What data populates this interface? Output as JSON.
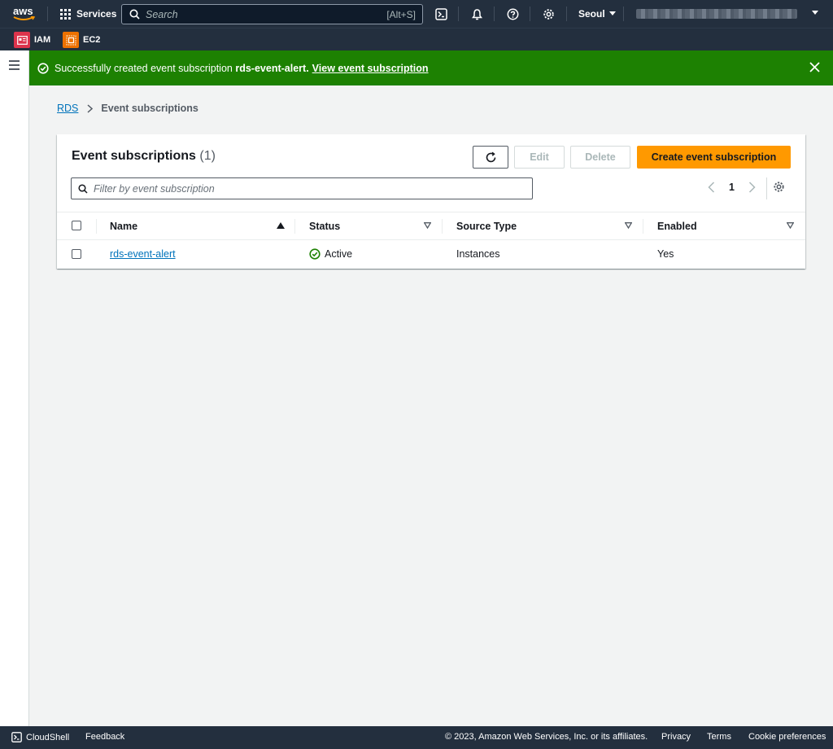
{
  "topnav": {
    "logo": "aws",
    "services_label": "Services",
    "search_placeholder": "Search",
    "search_shortcut": "[Alt+S]",
    "region_label": "Seoul",
    "brand_color": "#ff9900"
  },
  "favorites": [
    {
      "label": "IAM",
      "color": "#dd344c"
    },
    {
      "label": "EC2",
      "color": "#ed7100"
    }
  ],
  "flash": {
    "message": "Successfully created event subscription",
    "subscription_name": "rds-event-alert.",
    "link_label": "View event subscription",
    "color": "#1d8102"
  },
  "breadcrumb": {
    "root": "RDS",
    "current": "Event subscriptions"
  },
  "panel": {
    "title": "Event subscriptions",
    "count": "(1)",
    "edit_label": "Edit",
    "delete_label": "Delete",
    "create_label": "Create event subscription",
    "filter_placeholder": "Filter by event subscription",
    "page_number": "1"
  },
  "table": {
    "columns": [
      "Name",
      "Status",
      "Source Type",
      "Enabled"
    ],
    "rows": [
      {
        "name": "rds-event-alert",
        "status": "Active",
        "source_type": "Instances",
        "enabled": "Yes"
      }
    ]
  },
  "footer": {
    "cloudshell": "CloudShell",
    "feedback": "Feedback",
    "copyright": "© 2023, Amazon Web Services, Inc. or its affiliates.",
    "privacy": "Privacy",
    "terms": "Terms",
    "cookies": "Cookie preferences"
  }
}
